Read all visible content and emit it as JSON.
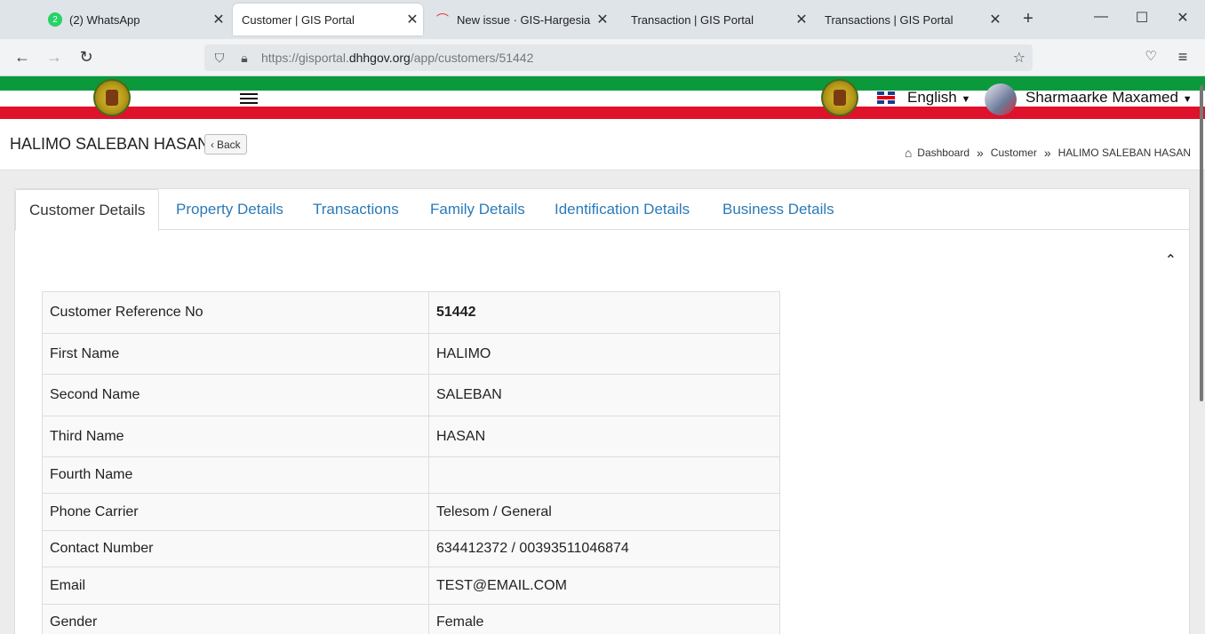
{
  "browser": {
    "tabs": [
      {
        "title": "(2) WhatsApp",
        "badge": "2",
        "active": false
      },
      {
        "title": "Customer | GIS Portal",
        "active": true
      },
      {
        "title": "New issue · GIS-Hargesia · Tea",
        "active": false
      },
      {
        "title": "Transaction | GIS Portal",
        "active": false
      },
      {
        "title": "Transactions | GIS Portal",
        "active": false
      }
    ],
    "url_prefix": "https://gisportal.",
    "url_domain": "dhhgov.org",
    "url_path": "/app/customers/51442"
  },
  "header": {
    "language": "English",
    "user_name": "Sharmaarke Maxamed"
  },
  "page": {
    "title": "HALIMO SALEBAN HASAN",
    "back_label": "Back",
    "breadcrumb": [
      "Dashboard",
      "Customer",
      "HALIMO SALEBAN HASAN"
    ]
  },
  "tabs": [
    "Customer Details",
    "Property Details",
    "Transactions",
    "Family Details",
    "Identification Details",
    "Business Details"
  ],
  "details": [
    {
      "label": "Customer Reference No",
      "value": "51442"
    },
    {
      "label": "First Name",
      "value": "HALIMO"
    },
    {
      "label": "Second Name",
      "value": "SALEBAN"
    },
    {
      "label": "Third Name",
      "value": "HASAN"
    },
    {
      "label": "Fourth Name",
      "value": ""
    },
    {
      "label": "Phone Carrier",
      "value": "Telesom / General"
    },
    {
      "label": "Contact Number",
      "value": "634412372 / 00393511046874"
    },
    {
      "label": "Email",
      "value": "TEST@EMAIL.COM"
    },
    {
      "label": "Gender",
      "value": "Female"
    }
  ],
  "colors": {
    "green": "#0a9a3c",
    "red": "#e0112b",
    "link": "#2a7ab8"
  }
}
